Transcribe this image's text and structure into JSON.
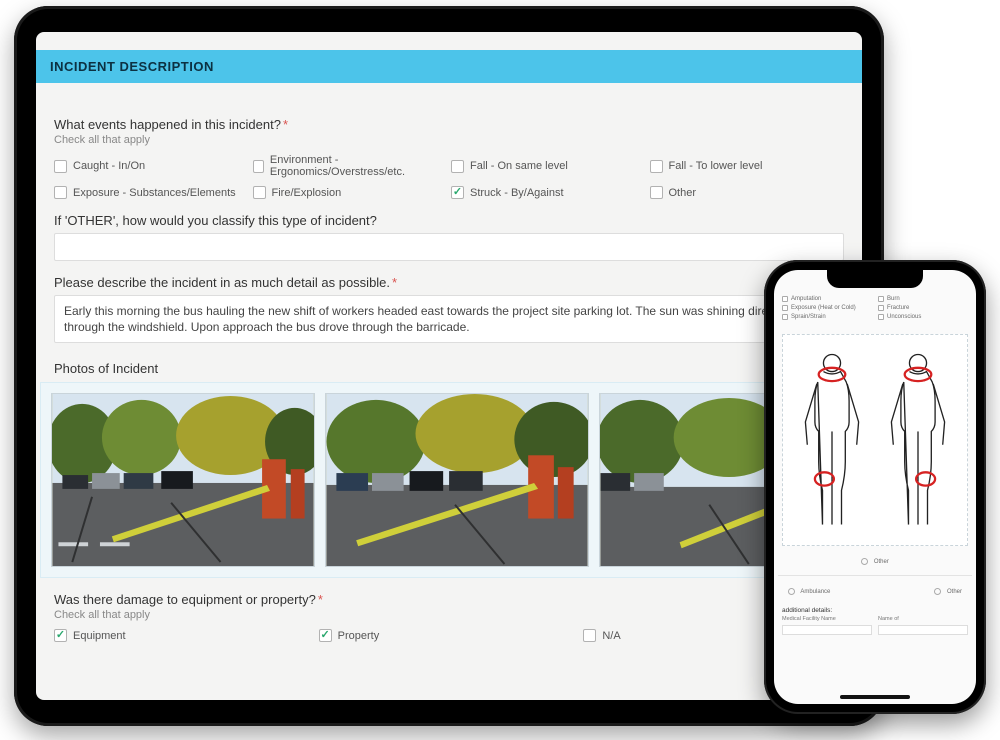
{
  "tablet": {
    "section_title": "INCIDENT DESCRIPTION",
    "q1": {
      "label": "What events happened in this incident?",
      "hint": "Check all that apply",
      "options": [
        {
          "label": "Caught - In/On",
          "checked": false
        },
        {
          "label": "Environment - Ergonomics/Overstress/etc.",
          "checked": false
        },
        {
          "label": "Fall - On same level",
          "checked": false
        },
        {
          "label": "Fall - To lower level",
          "checked": false
        },
        {
          "label": "Exposure - Substances/Elements",
          "checked": false
        },
        {
          "label": "Fire/Explosion",
          "checked": false
        },
        {
          "label": "Struck - By/Against",
          "checked": true
        },
        {
          "label": "Other",
          "checked": false
        }
      ]
    },
    "q2": {
      "label": "If 'OTHER', how would you classify this type of incident?",
      "value": ""
    },
    "q3": {
      "label": "Please describe the incident in as much detail as possible.",
      "value": "Early this morning the bus hauling the new shift of workers headed east towards the project site parking lot. The sun was shining directly in through the windshield. Upon approach the bus drove through the barricade."
    },
    "photos_label": "Photos of Incident",
    "q4": {
      "label": "Was there damage to equipment or property?",
      "hint": "Check all that apply",
      "options": [
        {
          "label": "Equipment",
          "checked": true
        },
        {
          "label": "Property",
          "checked": true
        },
        {
          "label": "N/A",
          "checked": false
        }
      ]
    }
  },
  "phone": {
    "symptoms": [
      {
        "label": "Amputation"
      },
      {
        "label": "Burn"
      },
      {
        "label": "Exposure (Heat or Cold)"
      },
      {
        "label": "Fracture"
      },
      {
        "label": "Sprain/Strain"
      },
      {
        "label": "Unconscious"
      }
    ],
    "radio_row1": [
      {
        "label": "Other"
      }
    ],
    "radio_row2": [
      {
        "label": "Ambulance"
      },
      {
        "label": "Other"
      }
    ],
    "details_label": "additional details:",
    "field1_label": "Medical Facility Name",
    "field2_label": "Name of"
  }
}
